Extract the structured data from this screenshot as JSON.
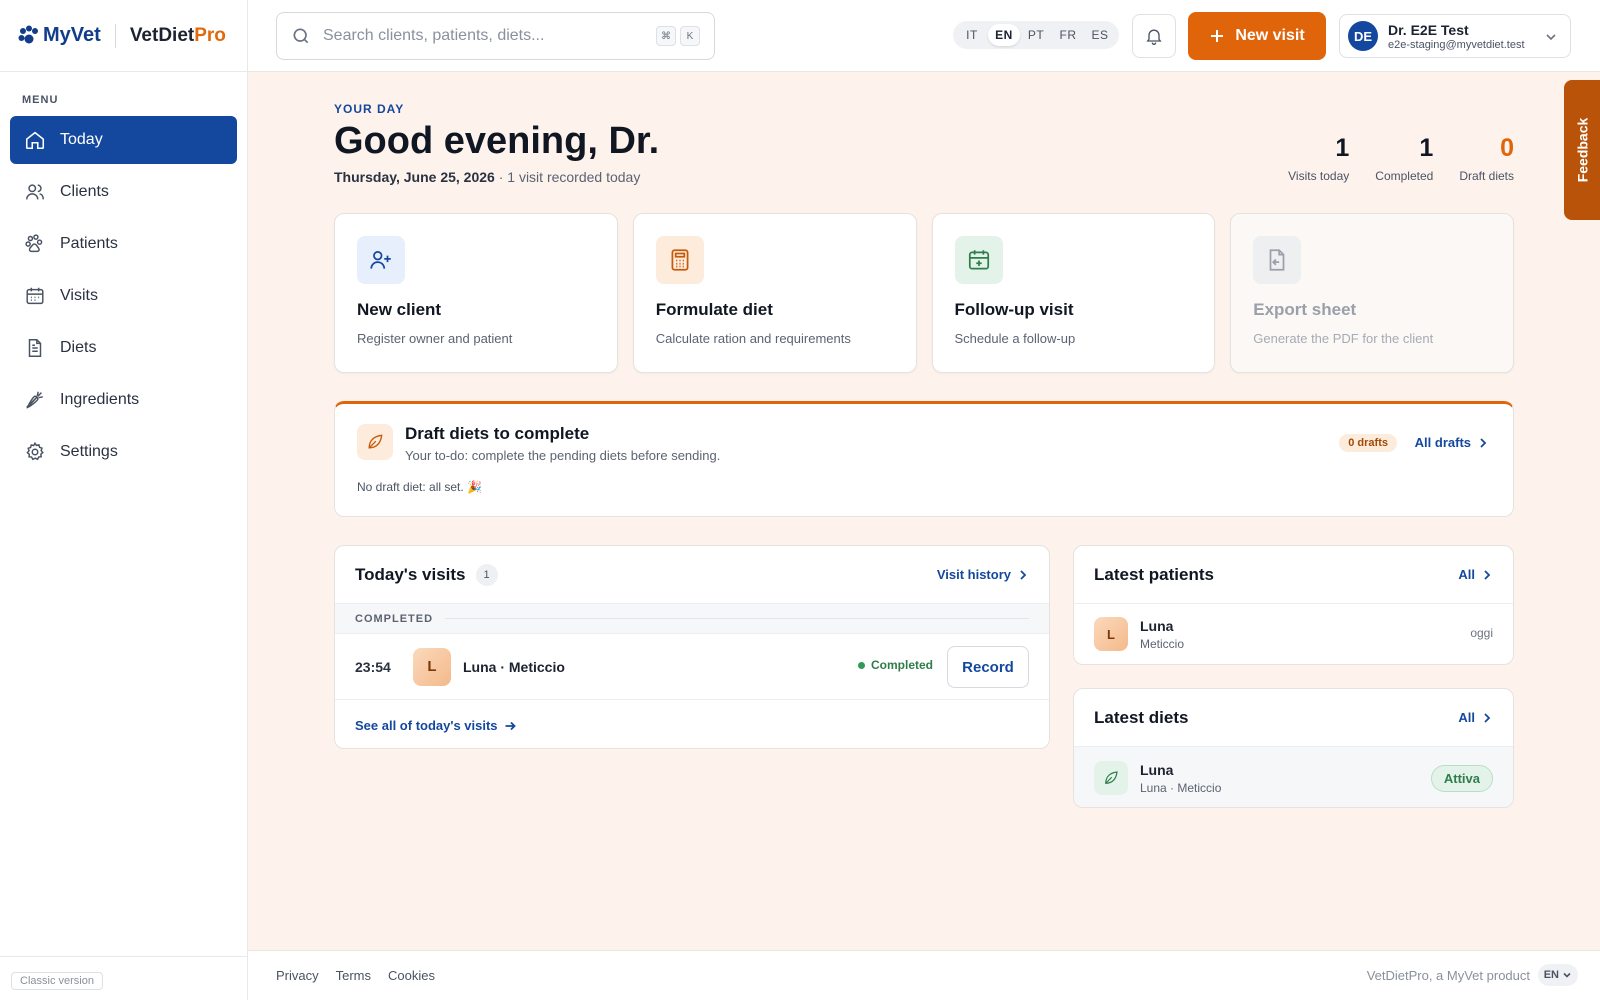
{
  "brand": {
    "myvet": "MyVet",
    "product_main": "VetDiet",
    "product_accent": "Pro"
  },
  "sidebar": {
    "menu_label": "MENU",
    "items": [
      {
        "label": "Today",
        "icon": "home-icon",
        "active": true
      },
      {
        "label": "Clients",
        "icon": "users-icon"
      },
      {
        "label": "Patients",
        "icon": "paw-icon"
      },
      {
        "label": "Visits",
        "icon": "calendar-icon"
      },
      {
        "label": "Diets",
        "icon": "document-icon"
      },
      {
        "label": "Ingredients",
        "icon": "carrot-icon"
      },
      {
        "label": "Settings",
        "icon": "gear-icon"
      }
    ],
    "classic_label": "Classic version"
  },
  "topbar": {
    "search_placeholder": "Search clients, patients, diets...",
    "shortcut_keys": [
      "⌘",
      "K"
    ],
    "languages": [
      "IT",
      "EN",
      "PT",
      "FR",
      "ES"
    ],
    "active_language": "EN",
    "new_visit_label": "New visit",
    "user": {
      "initials": "DE",
      "name": "Dr. E2E Test",
      "email": "e2e-staging@myvetdiet.test"
    }
  },
  "header": {
    "eyebrow": "YOUR DAY",
    "greeting": "Good evening, Dr.",
    "date": "Thursday, June 25, 2026",
    "date_suffix": "· 1 visit recorded today"
  },
  "stats": [
    {
      "value": "1",
      "label": "Visits today"
    },
    {
      "value": "1",
      "label": "Completed"
    },
    {
      "value": "0",
      "label": "Draft diets",
      "accent": "#e0650a"
    }
  ],
  "quick_actions": [
    {
      "title": "New client",
      "subtitle": "Register owner and patient",
      "icon": "user-plus-icon"
    },
    {
      "title": "Formulate diet",
      "subtitle": "Calculate ration and requirements",
      "icon": "calculator-icon"
    },
    {
      "title": "Follow-up visit",
      "subtitle": "Schedule a follow-up",
      "icon": "calendar-plus-icon"
    },
    {
      "title": "Export sheet",
      "subtitle": "Generate the PDF for the client",
      "icon": "file-export-icon",
      "disabled": true
    }
  ],
  "drafts": {
    "title": "Draft diets to complete",
    "subtitle": "Your to-do: complete the pending diets before sending.",
    "empty_text": "No draft diet: all set. 🎉",
    "badge": "0 drafts",
    "link": "All drafts"
  },
  "todays_visits": {
    "title": "Today's visits",
    "count": "1",
    "history_link": "Visit history",
    "group_label": "COMPLETED",
    "rows": [
      {
        "time": "23:54",
        "initial": "L",
        "name": "Luna · Meticcio",
        "status": "Completed",
        "action": "Record"
      }
    ],
    "see_all": "See all of today's visits"
  },
  "latest_patients": {
    "title": "Latest patients",
    "link": "All",
    "rows": [
      {
        "initial": "L",
        "name": "Luna",
        "breed": "Meticcio",
        "when": "oggi"
      }
    ]
  },
  "latest_diets": {
    "title": "Latest diets",
    "link": "All",
    "rows": [
      {
        "name": "Luna",
        "sub": "Luna · Meticcio",
        "status": "Attiva"
      }
    ]
  },
  "footer": {
    "links": [
      "Privacy",
      "Terms",
      "Cookies"
    ],
    "tagline": "VetDietPro, a MyVet product",
    "lang": "EN"
  },
  "feedback_label": "Feedback",
  "colors": {
    "primary": "#14489e",
    "accent": "#e0650a",
    "success": "#2f7d4a",
    "background": "#fdf3ec"
  }
}
